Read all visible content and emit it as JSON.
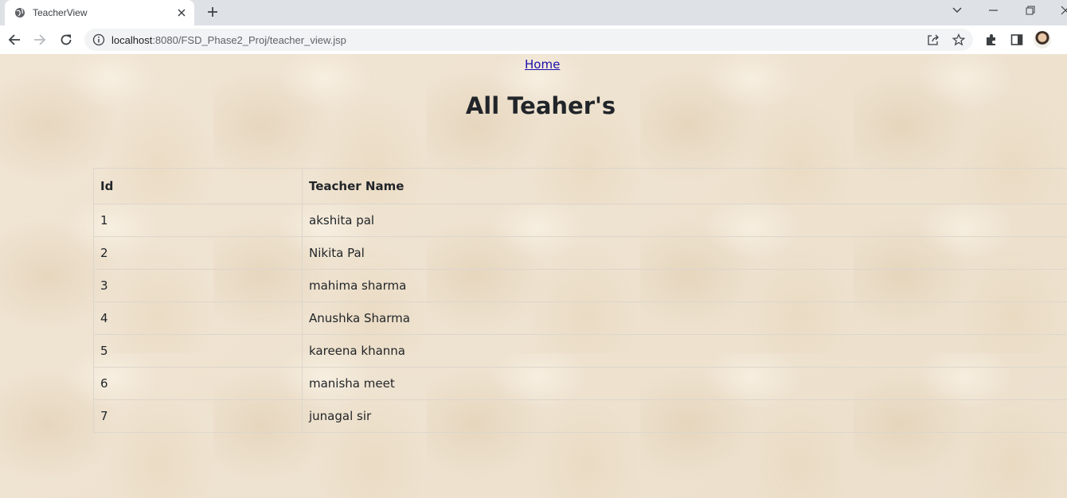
{
  "browser": {
    "tab": {
      "title": "TeacherView",
      "favicon": "globe-icon"
    },
    "url": {
      "host": "localhost",
      "path": ":8080/FSD_Phase2_Proj/teacher_view.jsp"
    }
  },
  "page": {
    "home_link": "Home",
    "title": "All Teaher's",
    "table": {
      "headers": {
        "id": "Id",
        "name": "Teacher Name"
      },
      "rows": [
        {
          "id": "1",
          "name": "akshita pal"
        },
        {
          "id": "2",
          "name": "Nikita Pal"
        },
        {
          "id": "3",
          "name": "mahima sharma"
        },
        {
          "id": "4",
          "name": "Anushka Sharma"
        },
        {
          "id": "5",
          "name": "kareena khanna"
        },
        {
          "id": "6",
          "name": "manisha meet"
        },
        {
          "id": "7",
          "name": "junagal sir"
        }
      ]
    }
  },
  "colors": {
    "link": "#1a0dab",
    "text": "#212529",
    "background": "#efe5d6",
    "chrome": "#dee1e6"
  }
}
